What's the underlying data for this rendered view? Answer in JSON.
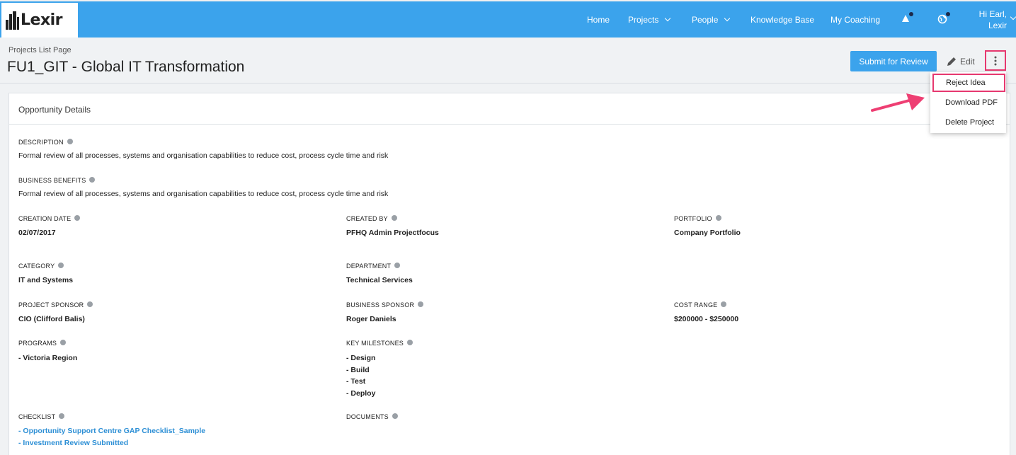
{
  "brand": {
    "name": "Lexir"
  },
  "nav": {
    "items": [
      {
        "label": "Home",
        "has_caret": false
      },
      {
        "label": "Projects",
        "has_caret": true
      },
      {
        "label": "People",
        "has_caret": true
      },
      {
        "label": "Knowledge Base",
        "has_caret": false
      },
      {
        "label": "My Coaching",
        "has_caret": false
      }
    ],
    "icons": [
      "alert-icon",
      "globe-icon"
    ],
    "user_greeting": "Hi Earl,",
    "user_name": "Lexir"
  },
  "page": {
    "breadcrumb": "Projects List Page",
    "title": "FU1_GIT - Global IT Transformation"
  },
  "actions": {
    "submit_label": "Submit for Review",
    "edit_label": "Edit",
    "more_icon": "kebab-icon",
    "menu": [
      "Reject Idea",
      "Download PDF",
      "Delete Project"
    ]
  },
  "card": {
    "title": "Opportunity Details",
    "description_label": "DESCRIPTION",
    "description_value": "Formal review of all processes, systems and organisation capabilities to reduce cost, process cycle time and risk",
    "benefits_label": "BUSINESS BENEFITS",
    "benefits_value": "Formal review of all processes, systems and organisation capabilities to reduce cost, process cycle time and risk",
    "creation_date_label": "CREATION DATE",
    "creation_date_value": "02/07/2017",
    "created_by_label": "CREATED BY",
    "created_by_value": "PFHQ Admin Projectfocus",
    "portfolio_label": "PORTFOLIO",
    "portfolio_value": "Company Portfolio",
    "category_label": "CATEGORY",
    "category_value": "IT and Systems",
    "department_label": "DEPARTMENT",
    "department_value": "Technical Services",
    "project_sponsor_label": "PROJECT SPONSOR",
    "project_sponsor_value": "CIO (Clifford Balis)",
    "business_sponsor_label": "BUSINESS SPONSOR",
    "business_sponsor_value": "Roger Daniels",
    "cost_range_label": "COST RANGE",
    "cost_range_value": "$200000 - $250000",
    "programs_label": "PROGRAMS",
    "programs_values": [
      "- Victoria Region"
    ],
    "milestones_label": "KEY MILESTONES",
    "milestones_values": [
      "- Design",
      "- Build",
      "- Test",
      "- Deploy"
    ],
    "checklist_label": "CHECKLIST",
    "checklist_prefix": "- ",
    "checklist_links": [
      "Opportunity Support Centre GAP Checklist_Sample",
      "Investment Review Submitted"
    ],
    "documents_label": "DOCUMENTS"
  },
  "colors": {
    "nav": "#3ba3ec",
    "highlight": "#e6386f",
    "link": "#2d8fd5"
  }
}
